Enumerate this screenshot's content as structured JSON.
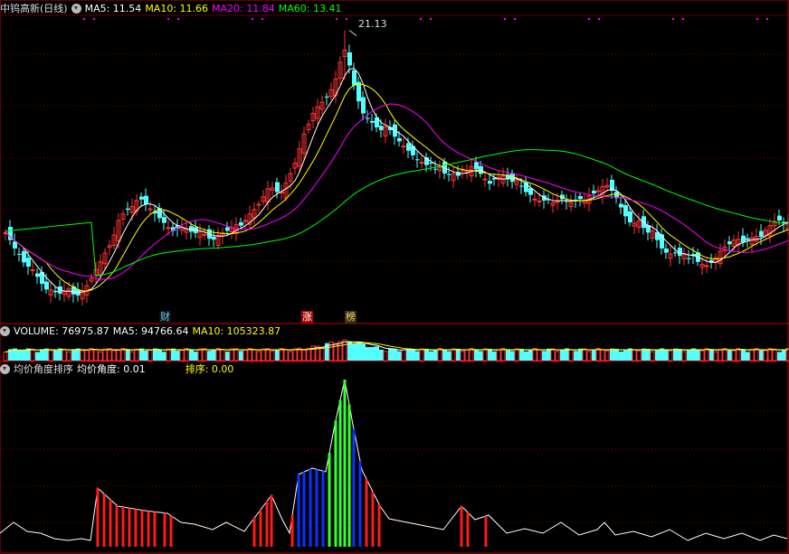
{
  "price_panel": {
    "title": "中钨高新(日线)",
    "ma5_label": "MA5: 11.54",
    "ma10_label": "MA10: 11.66",
    "ma20_label": "MA20: 11.84",
    "ma60_label": "MA60: 13.41",
    "high_label": "21.13",
    "events": [
      "财",
      "涨",
      "榜"
    ]
  },
  "volume_panel": {
    "volume_label": "VOLUME: 76975.87",
    "ma5_label": "MA5: 94766.64",
    "ma10_label": "MA10: 105323.87"
  },
  "indicator_panel": {
    "title": "均价角度排序",
    "angle_label": "均价角度: 0.01",
    "rank_label": "排序: 0.00"
  },
  "colors": {
    "up": "#ff3232",
    "down": "#54ffff",
    "ma5": "#ffffff",
    "ma10": "#ffff00",
    "ma20": "#ff00ff",
    "ma60": "#00ff00",
    "bar_red": "#ff1a1a",
    "bar_blue": "#0a32ff",
    "bar_green": "#33ff33"
  },
  "chart_data": {
    "type": "candlestick",
    "symbol": "中钨高新",
    "period": "日线",
    "high_marker": 21.13,
    "ma_last": {
      "MA5": 11.54,
      "MA10": 11.66,
      "MA20": 11.84,
      "MA60": 13.41
    },
    "volume_last": 76975.87,
    "volume_ma5": 94766.64,
    "volume_ma10": 105323.87,
    "angle_last": 0.01,
    "rank_last": 0.0
  }
}
